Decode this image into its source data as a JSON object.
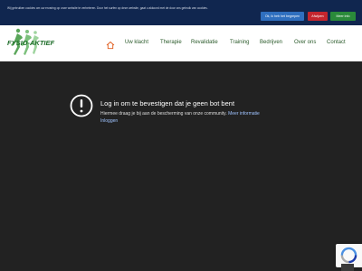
{
  "cookie_bar": {
    "text": "Wij gebruiken cookies om uw ervaring op onze website te verbeteren. Door het surfen op deze website, gaat u akkoord met de door ons gebruik van cookies.",
    "accept_label": "Ok, ik heb het begrepen",
    "decline_label": "Afwijzen",
    "info_label": "Meer info"
  },
  "header": {
    "logo_text": "FYSIO-AKTIEF",
    "nav": [
      {
        "label": "Uw klacht"
      },
      {
        "label": "Therapie"
      },
      {
        "label": "Revalidatie"
      },
      {
        "label": "Training"
      },
      {
        "label": "Bedrijven"
      },
      {
        "label": "Over ons"
      },
      {
        "label": "Contact"
      }
    ]
  },
  "message": {
    "title": "Log in om te bevestigen dat je geen bot bent",
    "body": "Hiermee draag je bij aan de bescherming van onze community.",
    "more_link": "Meer informatie",
    "login_link": "Inloggen"
  },
  "icons": {
    "home": "home-icon",
    "warning": "exclamation-circle-icon",
    "recaptcha": "recaptcha-icon"
  },
  "colors": {
    "cookie_bar_bg": "#10264f",
    "accept": "#2f6fbf",
    "decline": "#c4262e",
    "info": "#2a8a3a",
    "main_bg": "#222222",
    "nav_accent": "#e05a1a"
  }
}
